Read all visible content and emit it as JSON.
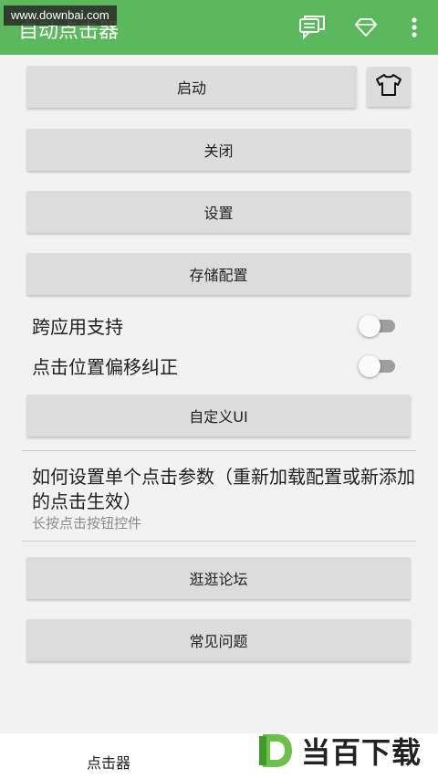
{
  "appbar": {
    "title": "自动点击器",
    "watermark": "www.downbai.com",
    "color": "#5cb85c",
    "icons": [
      "chat-icon",
      "diamond-icon",
      "more-vert-icon"
    ]
  },
  "buttons": {
    "start": "启动",
    "close": "关闭",
    "settings": "设置",
    "save_config": "存储配置",
    "custom_ui": "自定义UI",
    "forum": "逛逛论坛",
    "faq": "常见问题"
  },
  "switches": {
    "cross_app": {
      "label": "跨应用支持",
      "on": false
    },
    "offset_fix": {
      "label": "点击位置偏移纠正",
      "on": false
    }
  },
  "info": {
    "title": "如何设置单个点击参数（重新加载配置或新添加的点击生效）",
    "subtitle": "长按点击按钮控件"
  },
  "bottom": {
    "tab_label": "点击器",
    "logo_text": "当百下载"
  }
}
